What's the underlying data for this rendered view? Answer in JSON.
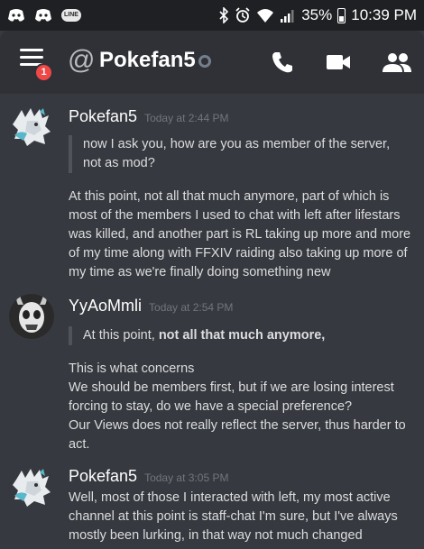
{
  "status_bar": {
    "battery_percent": "35%",
    "time": "10:39 PM",
    "notification_icons": [
      "discord-icon",
      "discord-icon",
      "line-icon"
    ],
    "line_label": "LINE",
    "system_icons": [
      "bluetooth-icon",
      "alarm-icon",
      "wifi-icon",
      "signal-icon",
      "battery-icon"
    ]
  },
  "header": {
    "menu_badge_count": "1",
    "at_symbol": "@",
    "channel_name": "Pokefan5",
    "actions": [
      "call-icon",
      "video-icon",
      "members-icon"
    ]
  },
  "messages": [
    {
      "author": "Pokefan5",
      "timestamp": "Today at 2:44 PM",
      "quote": "now I ask you, how are you as member of the server, not as mod?",
      "text": "At this point, not all that much anymore, part of which is most of the members I used to chat with left after lifestars was killed, and another part is RL taking up more and more of my time along with FFXIV raiding also taking up more of my time as we're finally doing something new"
    },
    {
      "author": "YyAoMmli",
      "timestamp": "Today at 2:54 PM",
      "quote_plain": "At this point, ",
      "quote_bold": "not all that much anymore,",
      "lines": [
        "This is what concerns",
        "We should be members first, but if we are losing interest forcing to stay, do we have a special preference?",
        "Our Views does not really reflect the server, thus harder to act."
      ]
    },
    {
      "author": "Pokefan5",
      "timestamp": "Today at 3:05 PM",
      "text": "Well, most of those I interacted with left, my most active channel at this point is staff-chat I'm sure, but I've always mostly been lurking, in that way not much changed"
    }
  ]
}
